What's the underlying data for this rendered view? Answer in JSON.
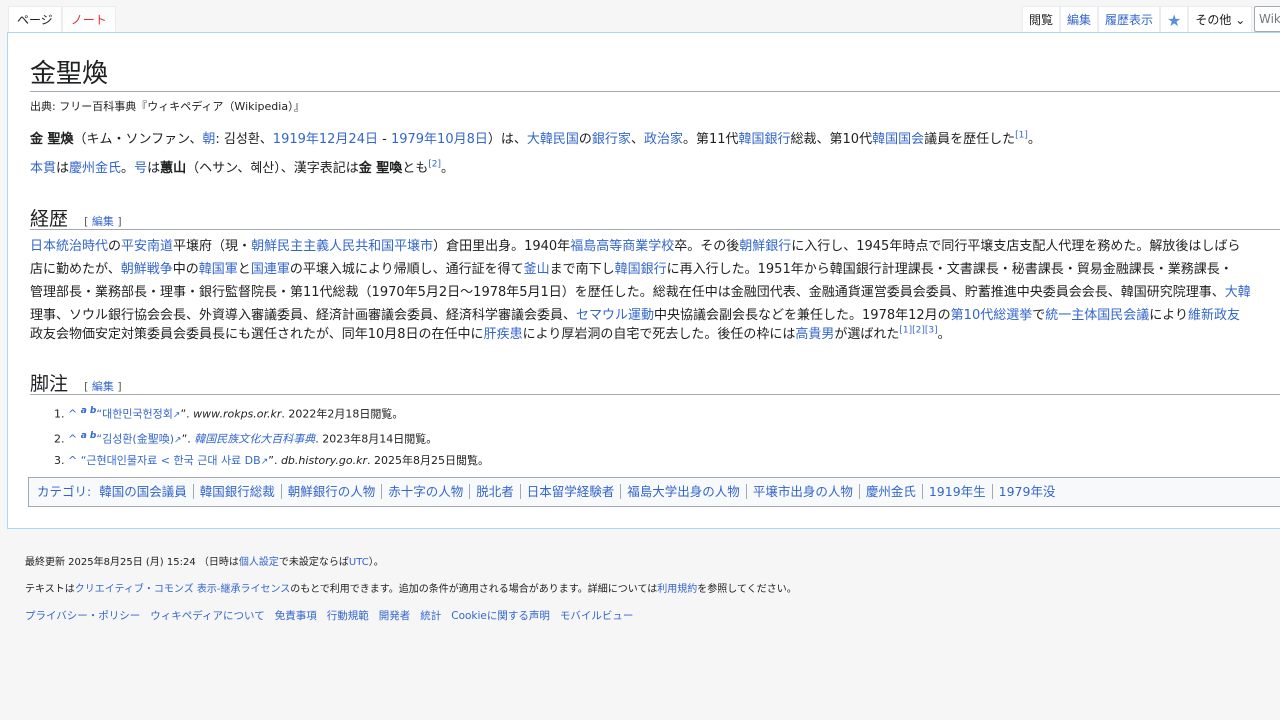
{
  "tabs": {
    "page": "ページ",
    "note": "ノート",
    "read": "閲覧",
    "edit": "編集",
    "history": "履歴表示",
    "watch_icon": "star-icon",
    "more": "その他",
    "search_placeholder": "Wiki"
  },
  "title": "金聖煥",
  "from": "出典: フリー百科事典『ウィキペディア（Wikipedia）』",
  "intro": {
    "p1": [
      {
        "t": "金 聖煥",
        "b": true
      },
      {
        "t": "（キム・ソンファン、"
      },
      {
        "t": "朝",
        "l": true
      },
      {
        "t": ": 김성환、"
      },
      {
        "t": "1919年",
        "l": true
      },
      {
        "t": "12月24日",
        "l": true
      },
      {
        "t": " - "
      },
      {
        "t": "1979年",
        "l": true
      },
      {
        "t": "10月8日",
        "l": true
      },
      {
        "t": "）は、"
      },
      {
        "t": "大韓民国",
        "l": true
      },
      {
        "t": "の"
      },
      {
        "t": "銀行家",
        "l": true
      },
      {
        "t": "、"
      },
      {
        "t": "政治家",
        "l": true
      },
      {
        "t": "。第11代"
      },
      {
        "t": "韓国銀行",
        "l": true
      },
      {
        "t": "総裁、第10代"
      },
      {
        "t": "韓国国会",
        "l": true
      },
      {
        "t": "議員を歴任した"
      },
      {
        "t": "[1]",
        "sup": true
      },
      {
        "t": "。"
      }
    ],
    "p2": [
      {
        "t": "本貫",
        "l": true
      },
      {
        "t": "は"
      },
      {
        "t": "慶州金氏",
        "l": true
      },
      {
        "t": "。"
      },
      {
        "t": "号",
        "l": true
      },
      {
        "t": "は"
      },
      {
        "t": "蕙山",
        "b": true
      },
      {
        "t": "（ヘサン、혜산）、漢字表記は"
      },
      {
        "t": "金 聖喚",
        "b": true
      },
      {
        "t": "とも"
      },
      {
        "t": "[2]",
        "sup": true
      },
      {
        "t": "。"
      }
    ]
  },
  "career": {
    "heading": "経歴",
    "edit": "編集",
    "lines": [
      [
        {
          "t": "日本統治時代",
          "l": true
        },
        {
          "t": "の"
        },
        {
          "t": "平安南道",
          "l": true
        },
        {
          "t": "平壌府（現・"
        },
        {
          "t": "朝鮮民主主義人民共和国",
          "l": true
        },
        {
          "t": "平壌市",
          "l": true
        },
        {
          "t": "）倉田里出身。1940年"
        },
        {
          "t": "福島高等商業学校",
          "l": true
        },
        {
          "t": "卒。その後"
        },
        {
          "t": "朝鮮銀行",
          "l": true
        },
        {
          "t": "に入行し、1945年時点で同行平壌支店支配人代理を務めた。解放後はしばら"
        }
      ],
      [
        {
          "t": "店に勤めたが、"
        },
        {
          "t": "朝鮮戦争",
          "l": true
        },
        {
          "t": "中の"
        },
        {
          "t": "韓国軍",
          "l": true
        },
        {
          "t": "と"
        },
        {
          "t": "国連軍",
          "l": true
        },
        {
          "t": "の平壌入城により帰順し、通行証を得て"
        },
        {
          "t": "釜山",
          "l": true
        },
        {
          "t": "まで南下し"
        },
        {
          "t": "韓国銀行",
          "l": true
        },
        {
          "t": "に再入行した。1951年から韓国銀行計理課長・文書課長・秘書課長・貿易金融課長・業務課長・"
        }
      ],
      [
        {
          "t": "管理部長・業務部長・理事・銀行監督院長・第11代総裁（1970年5月2日〜1978年5月1日）を歴任した。総裁在任中は金融団代表、金融通貨運営委員会委員、貯蓄推進中央委員会会長、韓国研究院理事、"
        },
        {
          "t": "大韓",
          "l": true
        }
      ],
      [
        {
          "t": "理事、ソウル銀行協会会長、外資導入審議委員、経済計画審議会委員、経済科学審議会委員、"
        },
        {
          "t": "セマウル運動",
          "l": true
        },
        {
          "t": "中央協議会副会長などを兼任した。1978年12月の"
        },
        {
          "t": "第10代総選挙",
          "l": true
        },
        {
          "t": "で"
        },
        {
          "t": "統一主体国民会議",
          "l": true
        },
        {
          "t": "により"
        },
        {
          "t": "維新政友",
          "l": true
        }
      ],
      [
        {
          "t": "政友会物価安定対策委員会委員長にも選任されたが、同年10月8日の在任中に"
        },
        {
          "t": "肝疾患",
          "l": true
        },
        {
          "t": "により厚岩洞の自宅で死去した。後任の枠には"
        },
        {
          "t": "高貴男",
          "l": true
        },
        {
          "t": "が選ばれた"
        },
        {
          "t": "[1][2][3]",
          "sup": true
        },
        {
          "t": "。"
        }
      ]
    ]
  },
  "notes": {
    "heading": "脚注",
    "edit": "編集",
    "items": [
      {
        "num": "1.",
        "caret": "^",
        "letters": "a b",
        "title": "“대한민국헌정회",
        "site": "www.rokps.or.kr",
        "date": ". 2022年2月18日閲覧。"
      },
      {
        "num": "2.",
        "caret": "^",
        "letters": "a b",
        "title": "“김성환(金聖喚)",
        "site": "韓国民族文化大百科事典",
        "date": ". 2023年8月14日閲覧。"
      },
      {
        "num": "3.",
        "caret": "^",
        "letters": "",
        "title": "“근현대인물자료 < 한국 근대 사료 DB",
        "site": "db.history.go.kr",
        "date": ". 2025年8月25日閲覧。"
      }
    ]
  },
  "categories": {
    "label": "カテゴリ:",
    "items": [
      "韓国の国会議員",
      "韓国銀行総裁",
      "朝鮮銀行の人物",
      "赤十字の人物",
      "脱北者",
      "日本留学経験者",
      "福島大学出身の人物",
      "平壌市出身の人物",
      "慶州金氏",
      "1919年生",
      "1979年没"
    ]
  },
  "footer": {
    "last_modified": [
      {
        "t": "最終更新 2025年8月25日 (月) 15:24 （日時は"
      },
      {
        "t": "個人設定",
        "l": true
      },
      {
        "t": "で未設定ならば"
      },
      {
        "t": "UTC",
        "l": true
      },
      {
        "t": "）。"
      }
    ],
    "license": [
      {
        "t": "テキストは"
      },
      {
        "t": "クリエイティブ・コモンズ 表示-継承ライセンス",
        "l": true
      },
      {
        "t": "のもとで利用できます。追加の条件が適用される場合があります。詳細については"
      },
      {
        "t": "利用規約",
        "l": true
      },
      {
        "t": "を参照してください。"
      }
    ],
    "links": [
      "プライバシー・ポリシー",
      "ウィキペディアについて",
      "免責事項",
      "行動規範",
      "開発者",
      "統計",
      "Cookieに関する声明",
      "モバイルビュー"
    ]
  }
}
